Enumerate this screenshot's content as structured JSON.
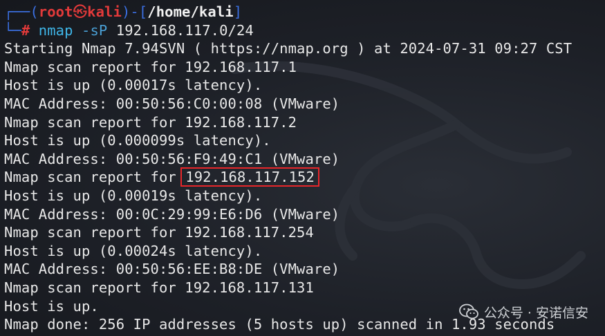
{
  "prompt": {
    "corner_top": "┌──(",
    "user": "root",
    "skull": "㉿",
    "host": "kali",
    "sep": ")-[",
    "path": "/home/kali",
    "close": "]",
    "corner_bottom": "└─",
    "hash": "# ",
    "cmd_bin": "nmap",
    "cmd_flag": "-sP",
    "cmd_arg": "192.168.117.0/24"
  },
  "output": {
    "start": "Starting Nmap 7.94SVN ( https://nmap.org ) at 2024-07-31 09:27 CST",
    "h1_report": "Nmap scan report for 192.168.117.1",
    "h1_up": "Host is up (0.00017s latency).",
    "h1_mac": "MAC Address: 00:50:56:C0:00:08 (VMware)",
    "h2_report": "Nmap scan report for 192.168.117.2",
    "h2_up": "Host is up (0.000099s latency).",
    "h2_mac": "MAC Address: 00:50:56:F9:49:C1 (VMware)",
    "h3_report_prefix": "Nmap scan report for ",
    "h3_ip": "192.168.117.152",
    "h3_up": "Host is up (0.00019s latency).",
    "h3_mac": "MAC Address: 00:0C:29:99:E6:D6 (VMware)",
    "h4_report": "Nmap scan report for 192.168.117.254",
    "h4_up": "Host is up (0.00024s latency).",
    "h4_mac": "MAC Address: 00:50:56:EE:B8:DE (VMware)",
    "h5_report": "Nmap scan report for 192.168.117.131",
    "h5_up": "Host is up.",
    "done": "Nmap done: 256 IP addresses (5 hosts up) scanned in 1.93 seconds"
  },
  "watermark": {
    "text": "公众号 · 安诺信安",
    "icon": "wechat-icon"
  },
  "colors": {
    "background": "#1a1d23",
    "prompt_root": "#e23a3a",
    "prompt_corner": "#3b6fe0",
    "command": "#3fb6e8",
    "highlight_box": "#e8262a",
    "text": "#e8e8e8"
  }
}
